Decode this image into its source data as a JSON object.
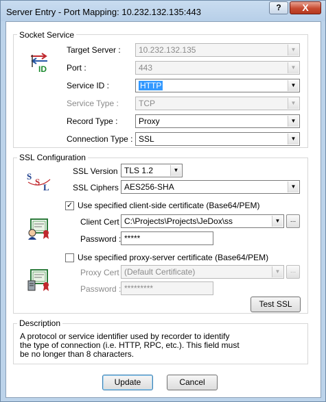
{
  "window": {
    "title": "Server Entry - Port Mapping: 10.232.132.135:443",
    "help": "?",
    "close": "X"
  },
  "socket": {
    "group_label": "Socket Service",
    "target_server": {
      "label": "Target Server :",
      "value": "10.232.132.135"
    },
    "port": {
      "label": "Port :",
      "value": "443"
    },
    "service_id": {
      "label": "Service ID :",
      "value": "HTTP"
    },
    "service_type": {
      "label": "Service Type :",
      "value": "TCP"
    },
    "record_type": {
      "label": "Record Type :",
      "value": "Proxy"
    },
    "connection_type": {
      "label": "Connection Type :",
      "value": "SSL"
    },
    "icon_text": "ID"
  },
  "ssl": {
    "group_label": "SSL Configuration",
    "icon_letters": [
      "S",
      "S",
      "L"
    ],
    "version": {
      "label": "SSL Version :",
      "value": "TLS 1.2"
    },
    "ciphers": {
      "label": "SSL Ciphers :",
      "value": "AES256-SHA"
    },
    "client_cert_check": {
      "label": "Use specified client-side certificate (Base64/PEM)",
      "checked": true,
      "mark": "✓"
    },
    "client_cert": {
      "label": "Client Cert :",
      "value": "C:\\Projects\\Projects\\JeDox\\ss"
    },
    "client_password": {
      "label": "Password :",
      "value": "*****"
    },
    "proxy_cert_check": {
      "label": "Use specified proxy-server certificate (Base64/PEM)",
      "checked": false,
      "mark": ""
    },
    "proxy_cert": {
      "label": "Proxy Cert :",
      "value": "(Default Certificate)"
    },
    "proxy_password": {
      "label": "Password :",
      "value": "*********"
    },
    "browse": "...",
    "test_ssl": "Test SSL"
  },
  "description": {
    "group_label": "Description",
    "lines": [
      "A protocol or service identifier used by recorder to identify",
      "the type of connection (i.e. HTTP, RPC, etc.).  This field must",
      "be no longer than 8 characters."
    ]
  },
  "buttons": {
    "update": "Update",
    "cancel": "Cancel"
  },
  "dropdown_arrow": "▼"
}
